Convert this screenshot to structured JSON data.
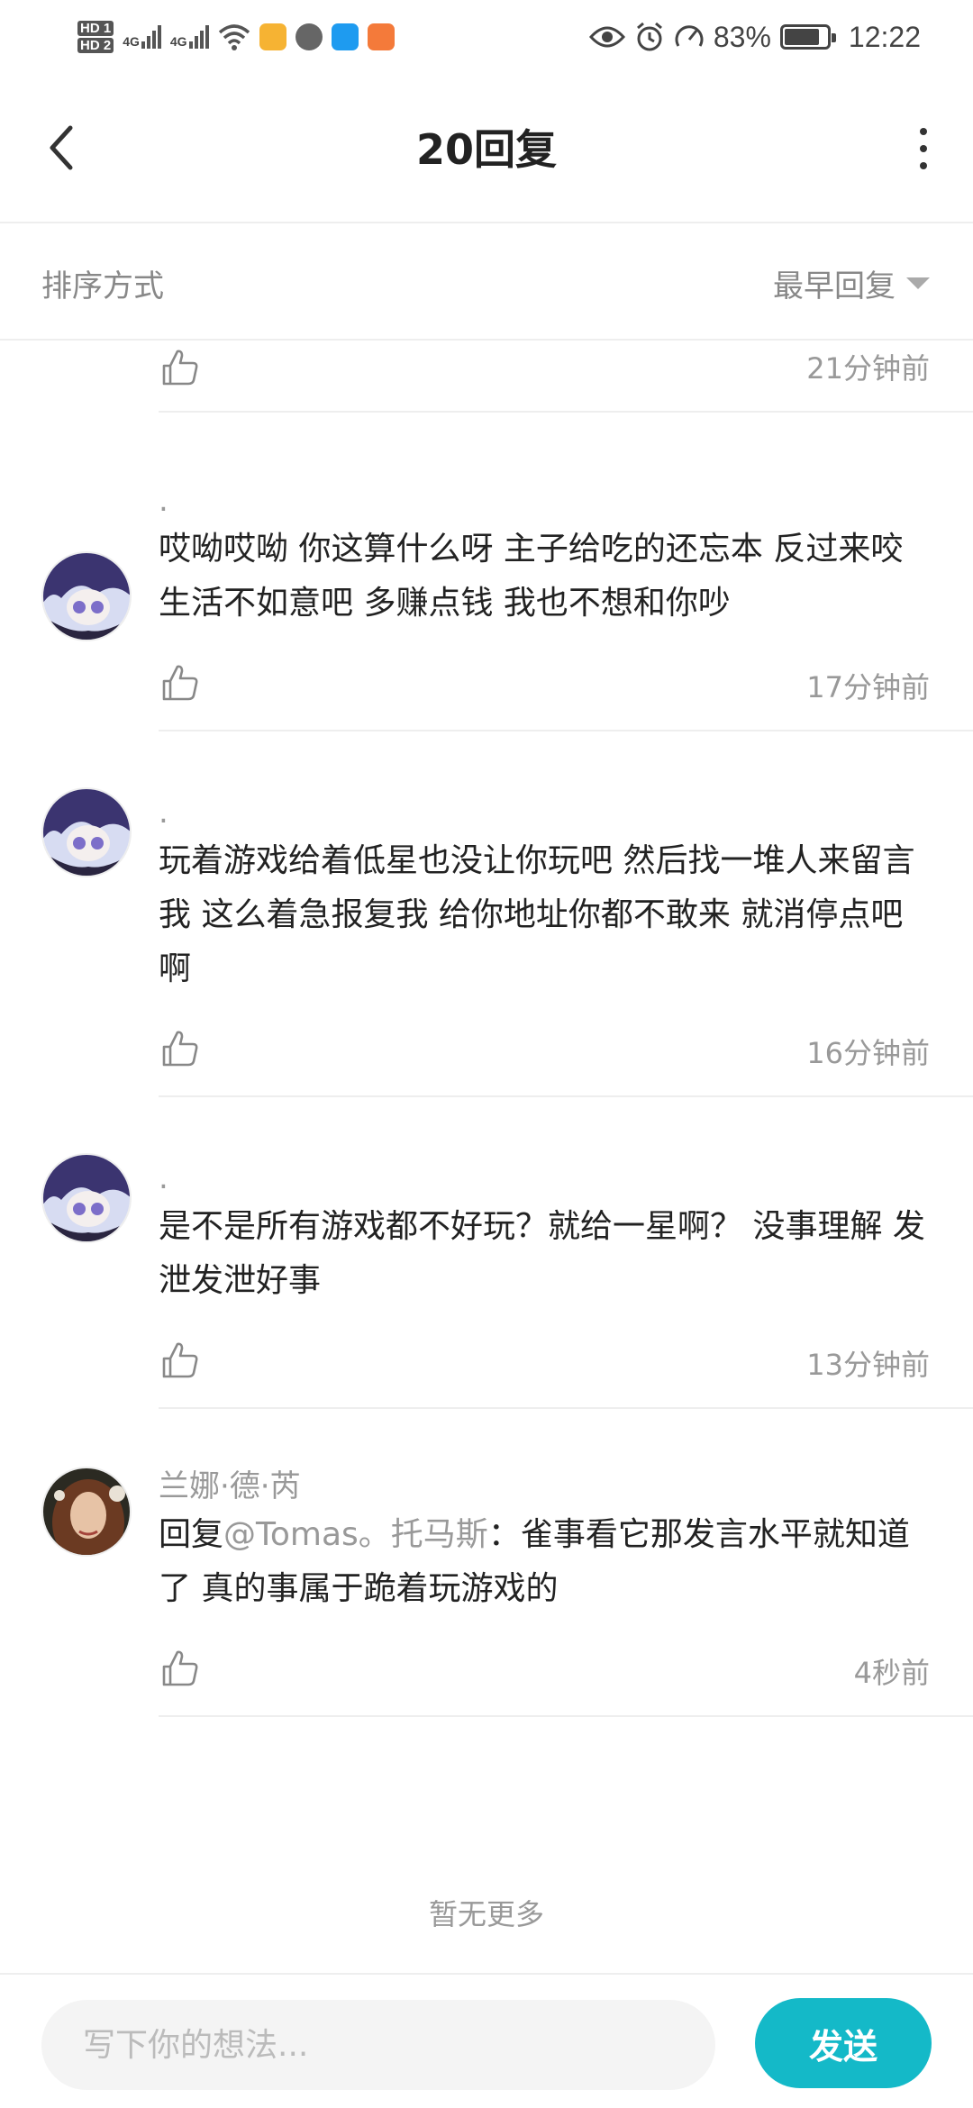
{
  "status_bar": {
    "hd1": "HD 1",
    "hd2": "HD 2",
    "net1": "4G",
    "net2": "4G",
    "battery": "83%",
    "time": "12:22"
  },
  "header": {
    "title": "20回复"
  },
  "sort": {
    "label": "排序方式",
    "value": "最早回复"
  },
  "partial_row": {
    "time": "21分钟前"
  },
  "comments": [
    {
      "username": ".",
      "text": "哎呦哎呦 你这算什么呀  主子给吃的还忘本  反过来咬  生活不如意吧 多赚点钱  我也不想和你吵",
      "time": "17分钟前"
    },
    {
      "username": ".",
      "text": "玩着游戏给着低星也没让你玩吧 然后找一堆人来留言我  这么着急报复我  给你地址你都不敢来 就消停点吧啊",
      "time": "16分钟前"
    },
    {
      "username": ".",
      "text": "是不是所有游戏都不好玩？就给一星啊？  没事理解 发泄发泄好事",
      "time": "13分钟前"
    },
    {
      "username": "兰娜·德·芮",
      "reply_prefix": "回复",
      "mention": "@Tomas。托马斯",
      "text": "：雀事看它那发言水平就知道了 真的事属于跪着玩游戏的",
      "time": "4秒前"
    }
  ],
  "footer_note": "暂无更多",
  "composer": {
    "placeholder": "写下你的想法...",
    "send_label": "发送"
  }
}
